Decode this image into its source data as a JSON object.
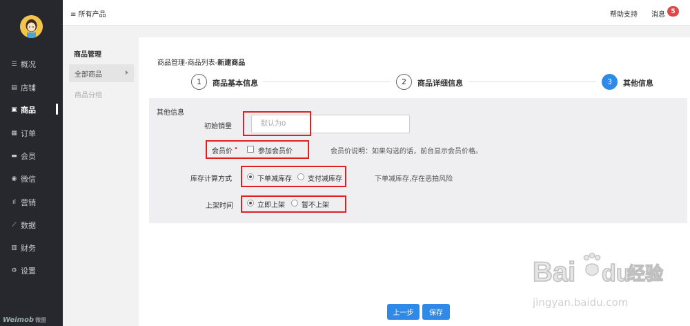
{
  "sidebar": {
    "items": [
      {
        "label": "概况",
        "icon": "list-icon"
      },
      {
        "label": "店铺",
        "icon": "store-icon"
      },
      {
        "label": "商品",
        "icon": "goods-icon"
      },
      {
        "label": "订单",
        "icon": "order-icon"
      },
      {
        "label": "会员",
        "icon": "member-card-icon"
      },
      {
        "label": "微信",
        "icon": "wechat-icon"
      },
      {
        "label": "营销",
        "icon": "marketing-icon"
      },
      {
        "label": "数据",
        "icon": "data-chart-icon"
      },
      {
        "label": "财务",
        "icon": "finance-icon"
      },
      {
        "label": "设置",
        "icon": "settings-icon"
      }
    ],
    "logo": "Weimob",
    "logo_sub": "微盟"
  },
  "topbar": {
    "all_products": "≡ 所有产品",
    "help": "帮助支持",
    "messages": "消息",
    "message_count": "5"
  },
  "submenu": {
    "title": "商品管理",
    "active_item": "全部商品",
    "item": "商品分组"
  },
  "main": {
    "breadcrumb_prefix": "商品管理-商品列表-",
    "breadcrumb_current": "新建商品",
    "steps": [
      {
        "num": "1",
        "label": "商品基本信息"
      },
      {
        "num": "2",
        "label": "商品详细信息"
      },
      {
        "num": "3",
        "label": "其他信息"
      }
    ],
    "active_step": 3
  },
  "form": {
    "section_title": "其他信息",
    "initial_sales_label": "初始销量",
    "initial_sales_placeholder": "默认为0",
    "member_price_label": "会员价",
    "required_mark": "•",
    "member_price_option": "参加会员价",
    "member_price_hint": "会员价说明：如果勾选的话，前台显示会员价格。",
    "stock_label": "库存计算方式",
    "stock_options": [
      "下单减库存",
      "支付减库存"
    ],
    "stock_selected": "下单减库存",
    "stock_hint": "下单减库存,存在恶拍风险",
    "shelf_label": "上架时间",
    "shelf_options": [
      "立即上架",
      "暂不上架"
    ],
    "shelf_selected": "立即上架"
  },
  "buttons": {
    "prev": "上一步",
    "save": "保存"
  },
  "watermark": {
    "brand": "Bai",
    "brand2": "du",
    "brand_cn": "经验",
    "url": "jingyan.baidu.com"
  },
  "colors": {
    "accent": "#2e8ae6",
    "sidebar_bg": "#27282d",
    "highlight_box": "#e02020",
    "badge": "#e04848"
  }
}
